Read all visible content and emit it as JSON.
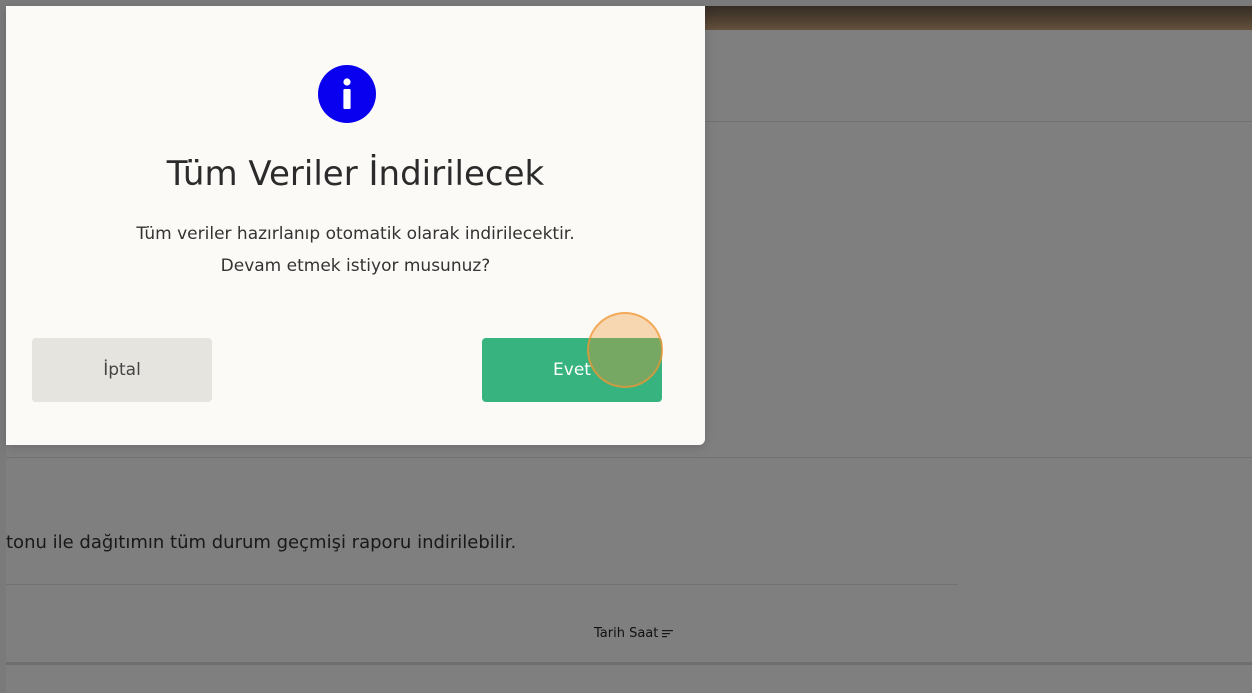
{
  "background": {
    "description_text": "tonu ile dağıtımın tüm durum geçmişi raporu indirilebilir.",
    "table_column_date": "Tarih Saat",
    "sort_icon": "sort-lines-icon"
  },
  "modal": {
    "icon": "info-icon",
    "icon_color": "#0a00f0",
    "title": "Tüm Veriler İndirilecek",
    "message_line1": "Tüm veriler hazırlanıp otomatik olarak indirilecektir.",
    "message_line2": "Devam etmek istiyor musunuz?",
    "cancel_label": "İptal",
    "confirm_label": "Evet",
    "confirm_color": "#36b37e"
  }
}
